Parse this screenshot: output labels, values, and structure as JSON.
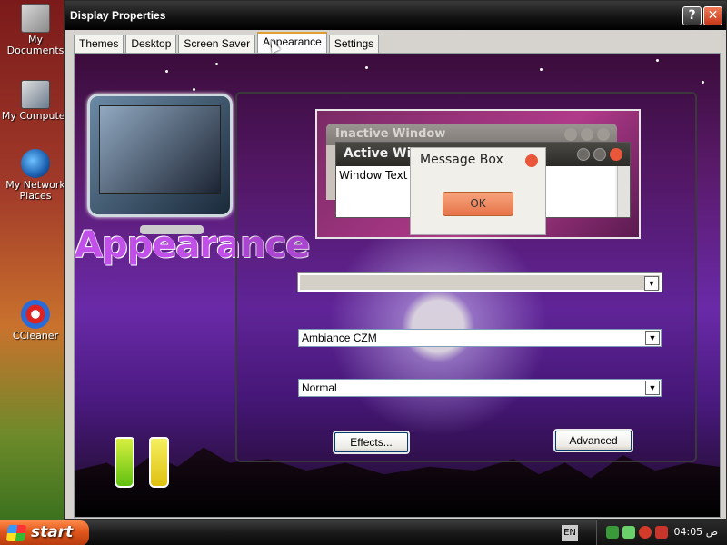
{
  "desktop": {
    "icons": [
      {
        "label": "My Documents",
        "icon": "documents-icon"
      },
      {
        "label": "My Computer",
        "icon": "computer-icon"
      },
      {
        "label": "My Network Places",
        "icon": "network-icon"
      },
      {
        "label": "CCleaner",
        "icon": "ccleaner-icon"
      }
    ]
  },
  "window": {
    "title": "Display Properties",
    "help_glyph": "?",
    "close_glyph": "✕",
    "tabs": [
      {
        "label": "Themes",
        "active": false
      },
      {
        "label": "Desktop",
        "active": false
      },
      {
        "label": "Screen Saver",
        "active": false
      },
      {
        "label": "Appearance",
        "active": true
      },
      {
        "label": "Settings",
        "active": false
      }
    ],
    "banner_text": "Appearance",
    "preview": {
      "inactive_title": "Inactive Window",
      "active_title": "Active Win",
      "window_text": "Window Text",
      "message_title": "Message Box",
      "ok_label": "OK"
    },
    "combos": {
      "windows_and_buttons": "",
      "color_scheme": "Ambiance CZM",
      "font_size": "Normal"
    },
    "buttons": {
      "effects": "Effects...",
      "advanced": "Advanced"
    }
  },
  "taskbar": {
    "start_label": "start",
    "language": "EN",
    "clock": "04:05 ص"
  },
  "colors": {
    "accent_orange": "#e6744a",
    "panel_purple": "#6a2aa8",
    "titlebar_black": "#141414"
  }
}
